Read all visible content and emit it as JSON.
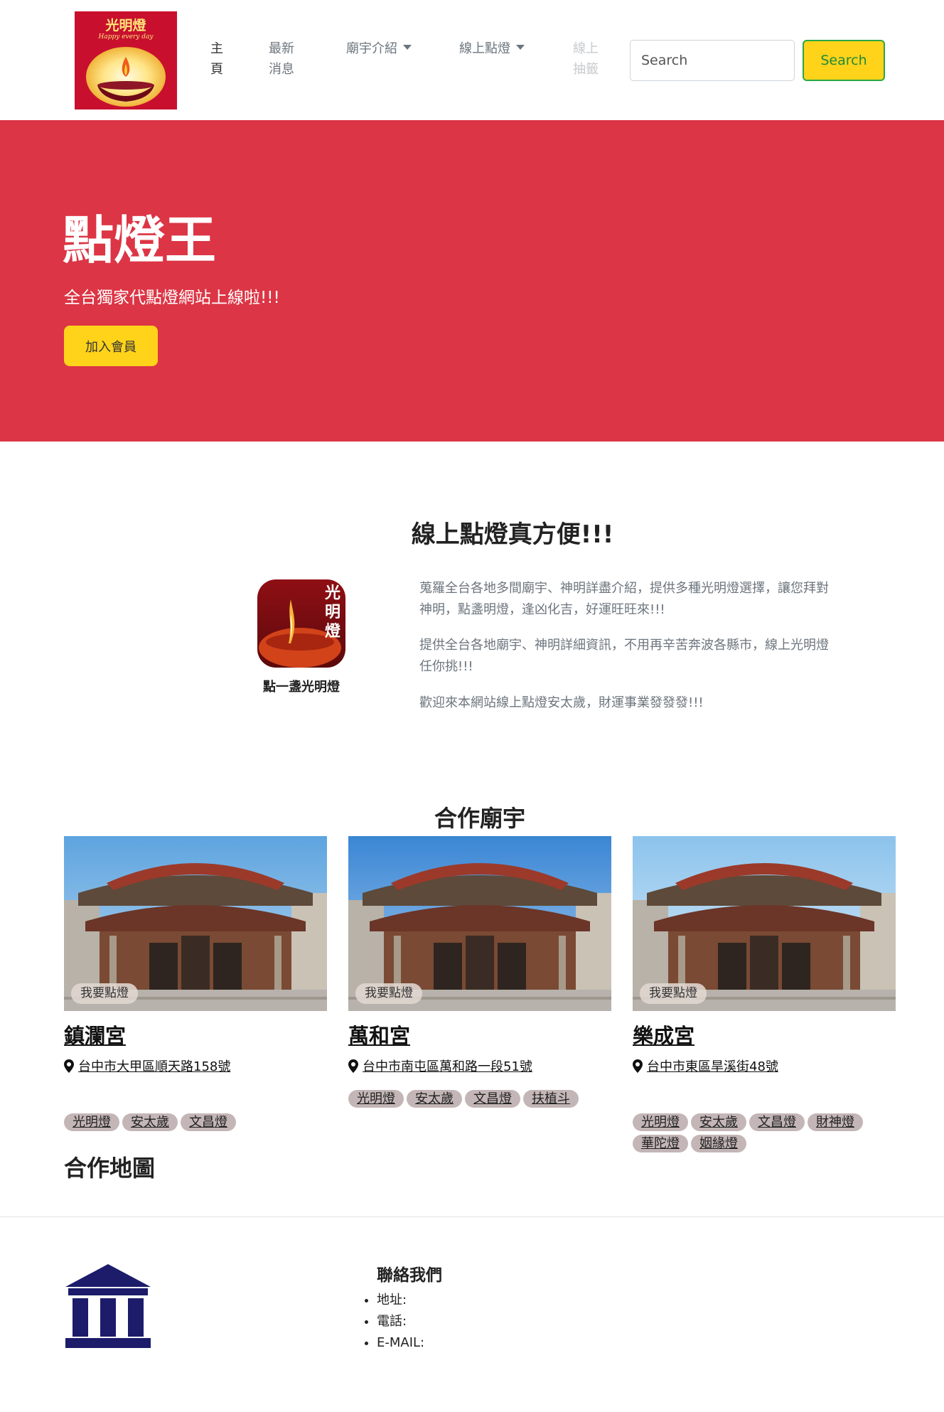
{
  "nav": {
    "logo": {
      "title": "光明燈",
      "subtitle": "Happy every day"
    },
    "links": [
      {
        "label": "主頁",
        "state": "active",
        "dropdown": false
      },
      {
        "label": "最新消息",
        "state": "normal",
        "dropdown": false
      },
      {
        "label": "廟宇介紹",
        "state": "normal",
        "dropdown": true
      },
      {
        "label": "線上點燈",
        "state": "normal",
        "dropdown": true
      },
      {
        "label": "線上抽籤",
        "state": "disabled",
        "dropdown": false
      }
    ],
    "search_placeholder": "Search",
    "search_button": "Search"
  },
  "hero": {
    "title": "點燈王",
    "subtitle": "全台獨家代點燈網站上線啦!!!",
    "button": "加入會員",
    "bg_color": "#dc3545",
    "button_color": "#ffd31a"
  },
  "intro": {
    "title": "線上點燈真方便!!!",
    "app_icon_text": "光明燈",
    "app_caption": "點一盞光明燈",
    "paragraphs": [
      "蒐羅全台各地多間廟宇、神明詳盡介紹，提供多種光明燈選擇，讓您拜對神明，點盞明燈，逢凶化吉，好運旺旺來!!!",
      "提供全台各地廟宇、神明詳細資訊，不用再辛苦奔波各縣市，線上光明燈任你挑!!!",
      "歡迎來本網站線上點燈安太歲，財運事業發發發!!!"
    ]
  },
  "temples": {
    "title": "合作廟宇",
    "badge": "我要點燈",
    "items": [
      {
        "name": "鎮瀾宮",
        "address": "台中市大甲區順天路158號",
        "tags": [
          "光明燈",
          "安太歲",
          "文昌燈"
        ]
      },
      {
        "name": "萬和宮",
        "address": "台中市南屯區萬和路一段51號",
        "tags": [
          "光明燈",
          "安太歲",
          "文昌燈",
          "扶植斗"
        ]
      },
      {
        "name": "樂成宮",
        "address": "台中市東區旱溪街48號",
        "tags": [
          "光明燈",
          "安太歲",
          "文昌燈",
          "財神燈",
          "華陀燈",
          "姻緣燈"
        ]
      }
    ]
  },
  "map": {
    "title": "合作地圖"
  },
  "footer": {
    "icon": "bank-icon",
    "contact_title": "聯絡我們",
    "contact_items": [
      "地址:",
      "電話:",
      "E-MAIL:"
    ]
  }
}
